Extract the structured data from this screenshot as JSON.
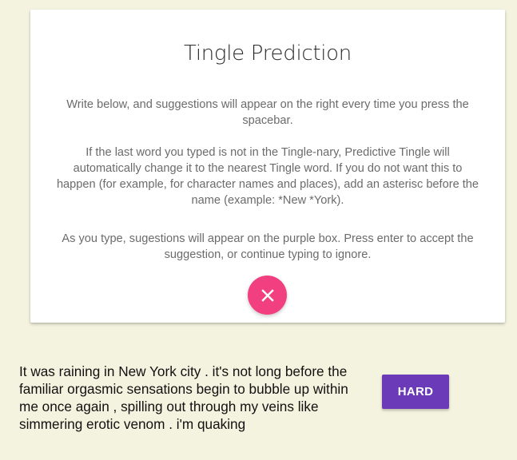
{
  "modal": {
    "title": "Tingle Prediction",
    "paragraph1": "Write below, and suggestions will appear on the right every time you press the spacebar.",
    "paragraph2": "If the last word you typed is not in the Tingle-nary, Predictive Tingle will automatically change it to the nearest Tingle word. If you do not want this to happen (for example, for character names and places), add an asterisc before the name (example: *New *York).",
    "paragraph3": "As you type, sugestions will appear on the purple box. Press enter to accept the suggestion, or continue typing to ignore.",
    "close_icon": "close-icon"
  },
  "editor": {
    "text": "It was raining in New York city . it's not long before the familiar orgasmic sensations begin to bubble up within me once again , spilling out through my veins like simmering erotic venom . i'm quaking"
  },
  "suggestion": {
    "label": "HARD"
  },
  "colors": {
    "background": "#f4f3df",
    "close_button": "#f13f7f",
    "suggestion_button": "#6a3ab9"
  }
}
